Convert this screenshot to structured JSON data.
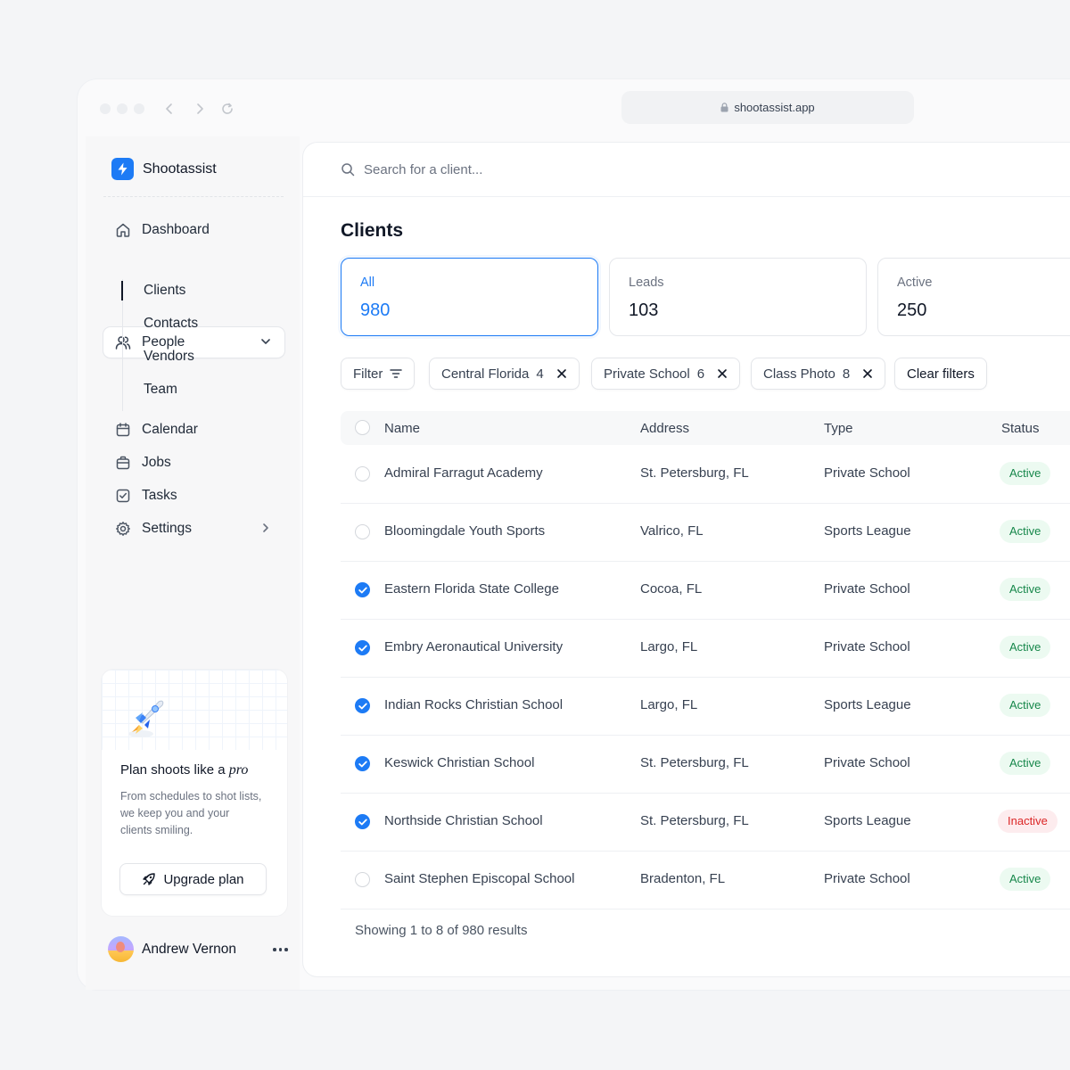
{
  "browser": {
    "url": "shootassist.app"
  },
  "brand": {
    "name": "Shootassist"
  },
  "nav": {
    "dashboard": "Dashboard",
    "people": "People",
    "people_sub": [
      "Clients",
      "Contacts",
      "Vendors",
      "Team"
    ],
    "calendar": "Calendar",
    "jobs": "Jobs",
    "tasks": "Tasks",
    "settings": "Settings"
  },
  "promo": {
    "title_prefix": "Plan shoots like a ",
    "title_emphasis": "pro",
    "text": "From schedules to shot lists, we keep you and your clients smiling.",
    "button": "Upgrade plan"
  },
  "user": {
    "name": "Andrew Vernon"
  },
  "search": {
    "placeholder": "Search for a client..."
  },
  "page": {
    "title": "Clients"
  },
  "cards": [
    {
      "label": "All",
      "value": "980",
      "selected": true
    },
    {
      "label": "Leads",
      "value": "103",
      "selected": false
    },
    {
      "label": "Active",
      "value": "250",
      "selected": false
    }
  ],
  "filters": {
    "filter_label": "Filter",
    "chips": [
      {
        "label": "Central Florida",
        "count": "4"
      },
      {
        "label": "Private School",
        "count": "6"
      },
      {
        "label": "Class Photo",
        "count": "8"
      }
    ],
    "clear": "Clear filters"
  },
  "table": {
    "headers": {
      "name": "Name",
      "address": "Address",
      "type": "Type",
      "status": "Status"
    },
    "rows": [
      {
        "name": "Admiral Farragut Academy",
        "address": "St. Petersburg, FL",
        "type": "Private School",
        "status": "Active",
        "checked": false
      },
      {
        "name": "Bloomingdale Youth Sports",
        "address": "Valrico, FL",
        "type": "Sports League",
        "status": "Active",
        "checked": false
      },
      {
        "name": "Eastern Florida State College",
        "address": "Cocoa, FL",
        "type": "Private School",
        "status": "Active",
        "checked": true
      },
      {
        "name": "Embry Aeronautical University",
        "address": "Largo, FL",
        "type": "Private School",
        "status": "Active",
        "checked": true
      },
      {
        "name": "Indian Rocks Christian School",
        "address": "Largo, FL",
        "type": "Sports League",
        "status": "Active",
        "checked": true
      },
      {
        "name": "Keswick Christian School",
        "address": "St. Petersburg, FL",
        "type": "Private School",
        "status": "Active",
        "checked": true
      },
      {
        "name": "Northside Christian School",
        "address": "St. Petersburg, FL",
        "type": "Sports League",
        "status": "Inactive",
        "checked": true
      },
      {
        "name": "Saint Stephen Episcopal School",
        "address": "Bradenton, FL",
        "type": "Private School",
        "status": "Active",
        "checked": false
      }
    ]
  },
  "footer": {
    "text": "Showing 1 to 8 of 980 results"
  },
  "colors": {
    "accent": "#1d7bf5",
    "active_text": "#16874a",
    "active_bg": "#ecfaf1",
    "inactive_text": "#dc2626",
    "inactive_bg": "#fdecee"
  }
}
